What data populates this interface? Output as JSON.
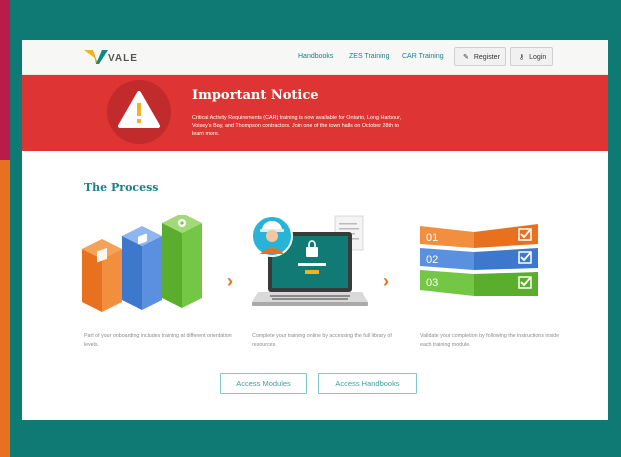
{
  "brand": {
    "name": "VALE"
  },
  "nav": {
    "items": [
      "Handbooks",
      "ZES Training",
      "CAR Training"
    ],
    "register": "Register",
    "login": "Login"
  },
  "notice": {
    "title": "Important Notice",
    "body": "Critical Activity Requirements (CAR) training is now available for Ontario, Long Harbour, Voisey's Bay, and Thompson contractors. Join one of the town halls on October 28th to learn more."
  },
  "process": {
    "title": "The Process",
    "steps": [
      {
        "caption": "Part of your onboarding includes training at different orientation levels."
      },
      {
        "caption": "Complete your training online by accessing the full library of resources."
      },
      {
        "caption": "Validate your completion by following the instructions inside each training module."
      }
    ],
    "numbers": [
      "01",
      "02",
      "03"
    ]
  },
  "actions": {
    "modules": "Access Modules",
    "handbooks": "Access Handbooks"
  },
  "colors": {
    "teal": "#0e7a73",
    "red": "#de3434",
    "orange": "#e8711f",
    "blue": "#4a86d8",
    "green": "#6cbf3a"
  }
}
